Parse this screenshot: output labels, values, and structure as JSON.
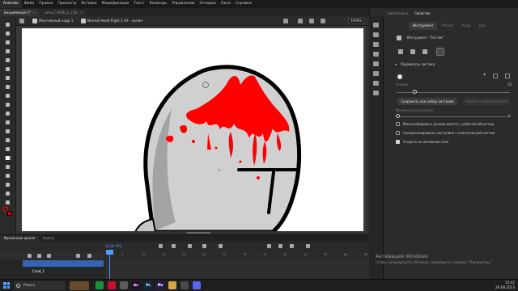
{
  "app": {
    "name": "Animate"
  },
  "menu": [
    "Файл",
    "Правка",
    "Просмотр",
    "Вставка",
    "Модификация",
    "Текст",
    "Команды",
    "Управление",
    "Отладка",
    "Окно",
    "Справка"
  ],
  "doc_tabs": [
    {
      "label": "Безымянный-1*",
      "active": true
    },
    {
      "label": "ничо_ГАНЗЕ_в_1.fla",
      "active": false
    }
  ],
  "scene_bar": {
    "symbol_1": "Монтажный кадр 1",
    "symbol_2": "Normal Head Right 2 SX - копия",
    "zoom": "1600%"
  },
  "timeline": {
    "tabs": [
      {
        "label": "Временная шкала",
        "active": true
      },
      {
        "label": "Вывод",
        "active": false
      }
    ],
    "fps": "24,00",
    "fps_unit": "FPS",
    "layer_name": "Слой_1",
    "frame_numbers": [
      "5",
      "10",
      "15",
      "20",
      "25",
      "30",
      "35",
      "40",
      "45",
      "50",
      "55",
      "60",
      "65"
    ]
  },
  "right_panel": {
    "head_tabs": [
      {
        "label": "Библиотека",
        "active": false
      },
      {
        "label": "Свойства",
        "active": true
      }
    ],
    "sub_tabs": [
      {
        "label": "Инструмент",
        "active": true
      },
      {
        "label": "Объект",
        "active": false
      },
      {
        "label": "Кадр",
        "active": false
      },
      {
        "label": "Док.",
        "active": false
      }
    ],
    "tool_title": "Инструмент \"Ластик\"",
    "section_title": "Параметры ластика",
    "size_label": "Размер",
    "size_value": "33",
    "save_button": "Сохранить как набор настроек",
    "delete_button": "Удалить набор настроек",
    "min_size_label": "Минимальный размер",
    "min_size_value": "0",
    "checkboxes": [
      {
        "label": "Масштабировать размер вместе с рабочей областью",
        "checked": false
      },
      {
        "label": "Синхронизировать настройки с классической кистью",
        "checked": false
      },
      {
        "label": "Стирать на активном слое",
        "checked": true
      }
    ]
  },
  "activation": {
    "title": "Активация Windows",
    "subtitle": "Чтобы активировать Windows, перейдите в раздел \"Параметры\"."
  },
  "taskbar": {
    "search_placeholder": "Поиск",
    "apps": [
      {
        "icon": "chrome-icon",
        "color": "#1f8f3a",
        "letter": ""
      },
      {
        "icon": "opera-icon",
        "color": "#c8102e",
        "letter": ""
      },
      {
        "icon": "files-icon",
        "color": "#5a5a5a",
        "letter": ""
      },
      {
        "icon": "animate-icon",
        "color": "#2a0a34",
        "letter": "An"
      },
      {
        "icon": "photoshop-icon",
        "color": "#0b2a45",
        "letter": "Ps"
      },
      {
        "icon": "media-encoder-icon",
        "color": "#2a1a55",
        "letter": "Me"
      },
      {
        "icon": "explorer-icon",
        "color": "#d9a441",
        "letter": ""
      },
      {
        "icon": "settings-icon",
        "color": "#4a4a4a",
        "letter": ""
      },
      {
        "icon": "discord-icon",
        "color": "#5865f2",
        "letter": ""
      }
    ],
    "time": "14:42",
    "date": "29.08.2023"
  },
  "colors": {
    "accent": "#4d9bff",
    "fill": "#d10000",
    "layer": "#3465b5",
    "ink": "#000000"
  }
}
